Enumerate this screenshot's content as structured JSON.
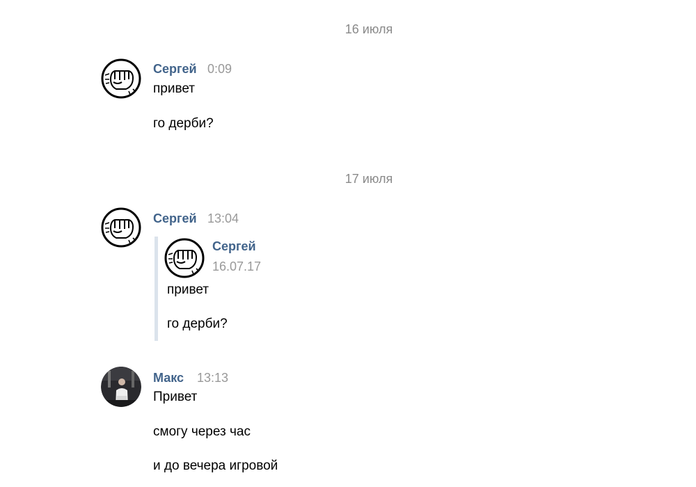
{
  "dates": [
    "16 июля",
    "17 июля"
  ],
  "messages": [
    {
      "author": "Сергей",
      "time": "0:09",
      "avatar": "fist-icon",
      "lines": [
        "привет",
        "го дерби?"
      ]
    },
    {
      "author": "Сергей",
      "time": "13:04",
      "avatar": "fist-icon",
      "forwarded": {
        "author": "Сергей",
        "date": "16.07.17",
        "avatar": "fist-icon",
        "lines": [
          "привет",
          "го дерби?"
        ]
      }
    },
    {
      "author": "Макс",
      "time": "13:13",
      "avatar": "user-photo",
      "lines": [
        "Привет",
        "смогу через час",
        "и до вечера игровой"
      ]
    }
  ],
  "colors": {
    "author": "#42648b",
    "time": "#999999",
    "date": "#8a8a8a",
    "forward_bar": "#dbe3ec"
  }
}
